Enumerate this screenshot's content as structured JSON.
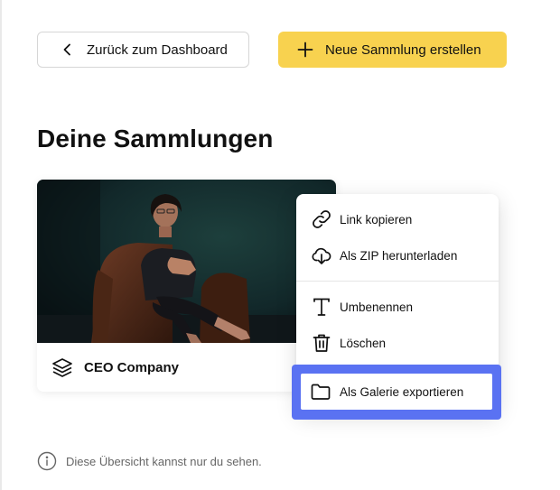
{
  "header": {
    "back_button": {
      "label": "Zurück zum Dashboard",
      "icon": "chevron-left-icon"
    },
    "new_collection_button": {
      "label": "Neue Sammlung erstellen",
      "icon": "plus-icon",
      "color": "#f8d24f"
    }
  },
  "page": {
    "title": "Deine Sammlungen"
  },
  "collections": [
    {
      "name": "CEO Company",
      "icon": "layers-icon"
    }
  ],
  "context_menu": {
    "items": [
      {
        "label": "Link kopieren",
        "icon": "link-icon"
      },
      {
        "label": "Als ZIP herunterladen",
        "icon": "cloud-download-icon"
      },
      {
        "label": "Umbenennen",
        "icon": "text-icon"
      },
      {
        "label": "Löschen",
        "icon": "trash-icon"
      }
    ],
    "highlighted_item": {
      "label": "Als Galerie exportieren",
      "icon": "folder-icon",
      "highlight_color": "#5a72f2"
    }
  },
  "footer_note": {
    "text": "Diese Übersicht kannst nur du sehen.",
    "icon": "info-icon"
  }
}
